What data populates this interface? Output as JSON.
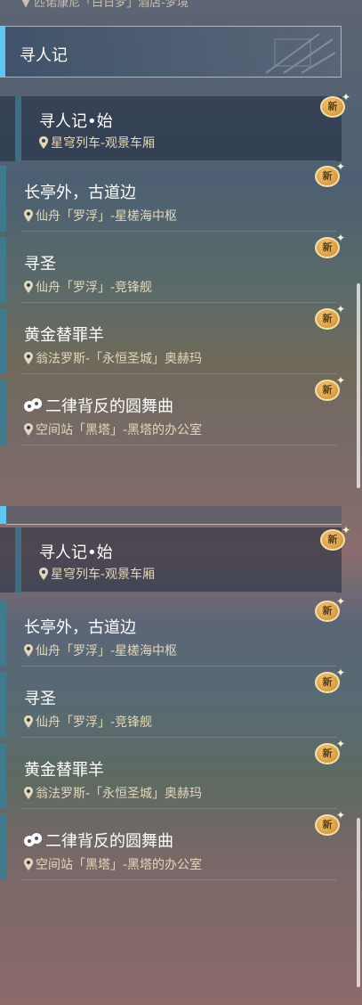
{
  "top_cut_text": "▼ 匹诺康尼「白日梦」酒店-梦境",
  "section_title": "寻人记",
  "new_badge_label": "新",
  "items": [
    {
      "name": "寻人记•始",
      "location": "星穹列车-观景车厢",
      "selected": true
    },
    {
      "name": "长亭外，古道边",
      "location": "仙舟「罗浮」-星槎海中枢"
    },
    {
      "name": "寻圣",
      "location": "仙舟「罗浮」-竞锋舰"
    },
    {
      "name": "黄金替罪羊",
      "location": "翁法罗斯-「永恒圣城」奥赫玛"
    },
    {
      "name": "二律背反的圆舞曲",
      "location": "空间站「黑塔」-黑塔的办公室",
      "icon": "mask-icon"
    }
  ],
  "colors": {
    "accent": "#5ac8f0",
    "badge": "#e8a94a",
    "location": "#e3d7bb"
  }
}
